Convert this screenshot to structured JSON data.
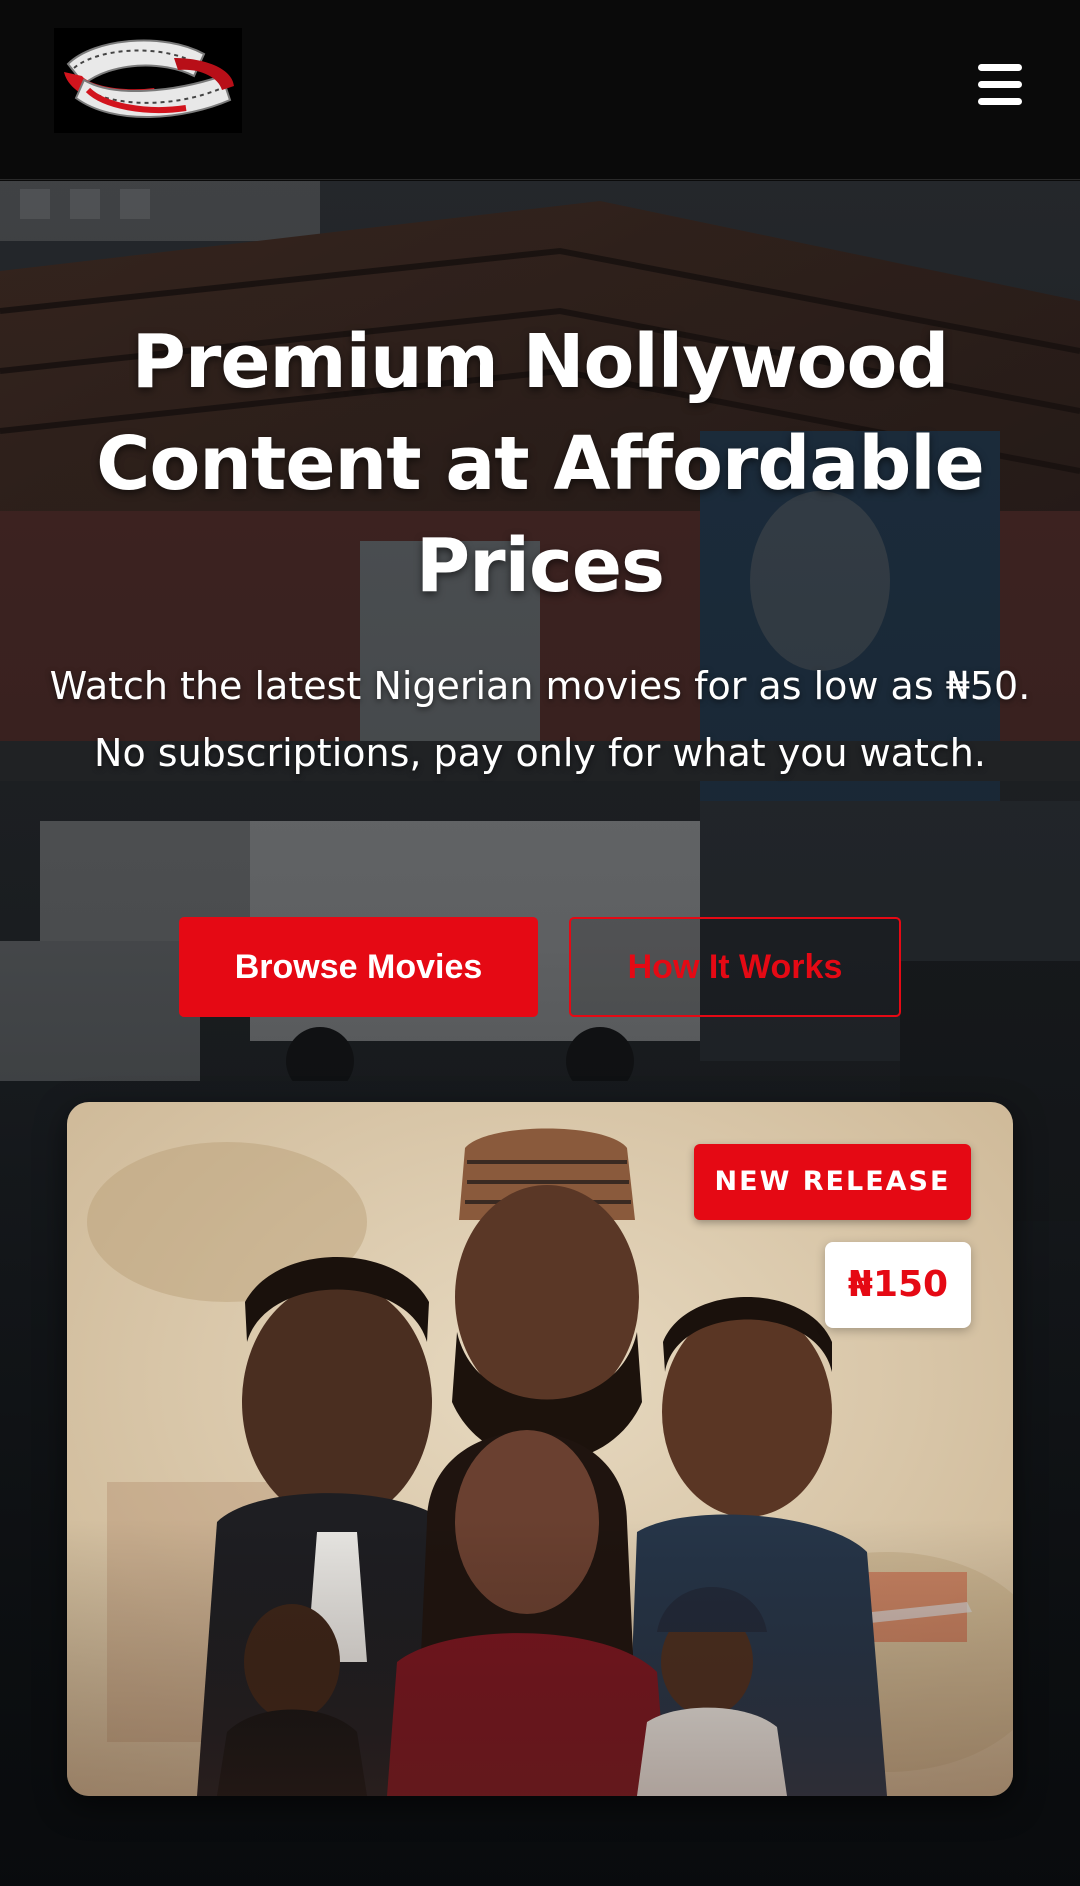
{
  "header": {
    "logo_icon": "film-reel-logo",
    "menu_icon": "hamburger-menu-icon"
  },
  "hero": {
    "title": "Premium Nollywood Content at Affordable Prices",
    "subtitle": "Watch the latest Nigerian movies for as low as ₦50. No subscriptions, pay only for what you watch.",
    "primary_button_label": "Browse Movies",
    "secondary_button_label": "How It Works"
  },
  "featured": {
    "badge_label": "NEW RELEASE",
    "price": "₦150"
  },
  "colors": {
    "accent": "#e50914",
    "header_bg": "#0a0a0a",
    "text": "#ffffff"
  }
}
